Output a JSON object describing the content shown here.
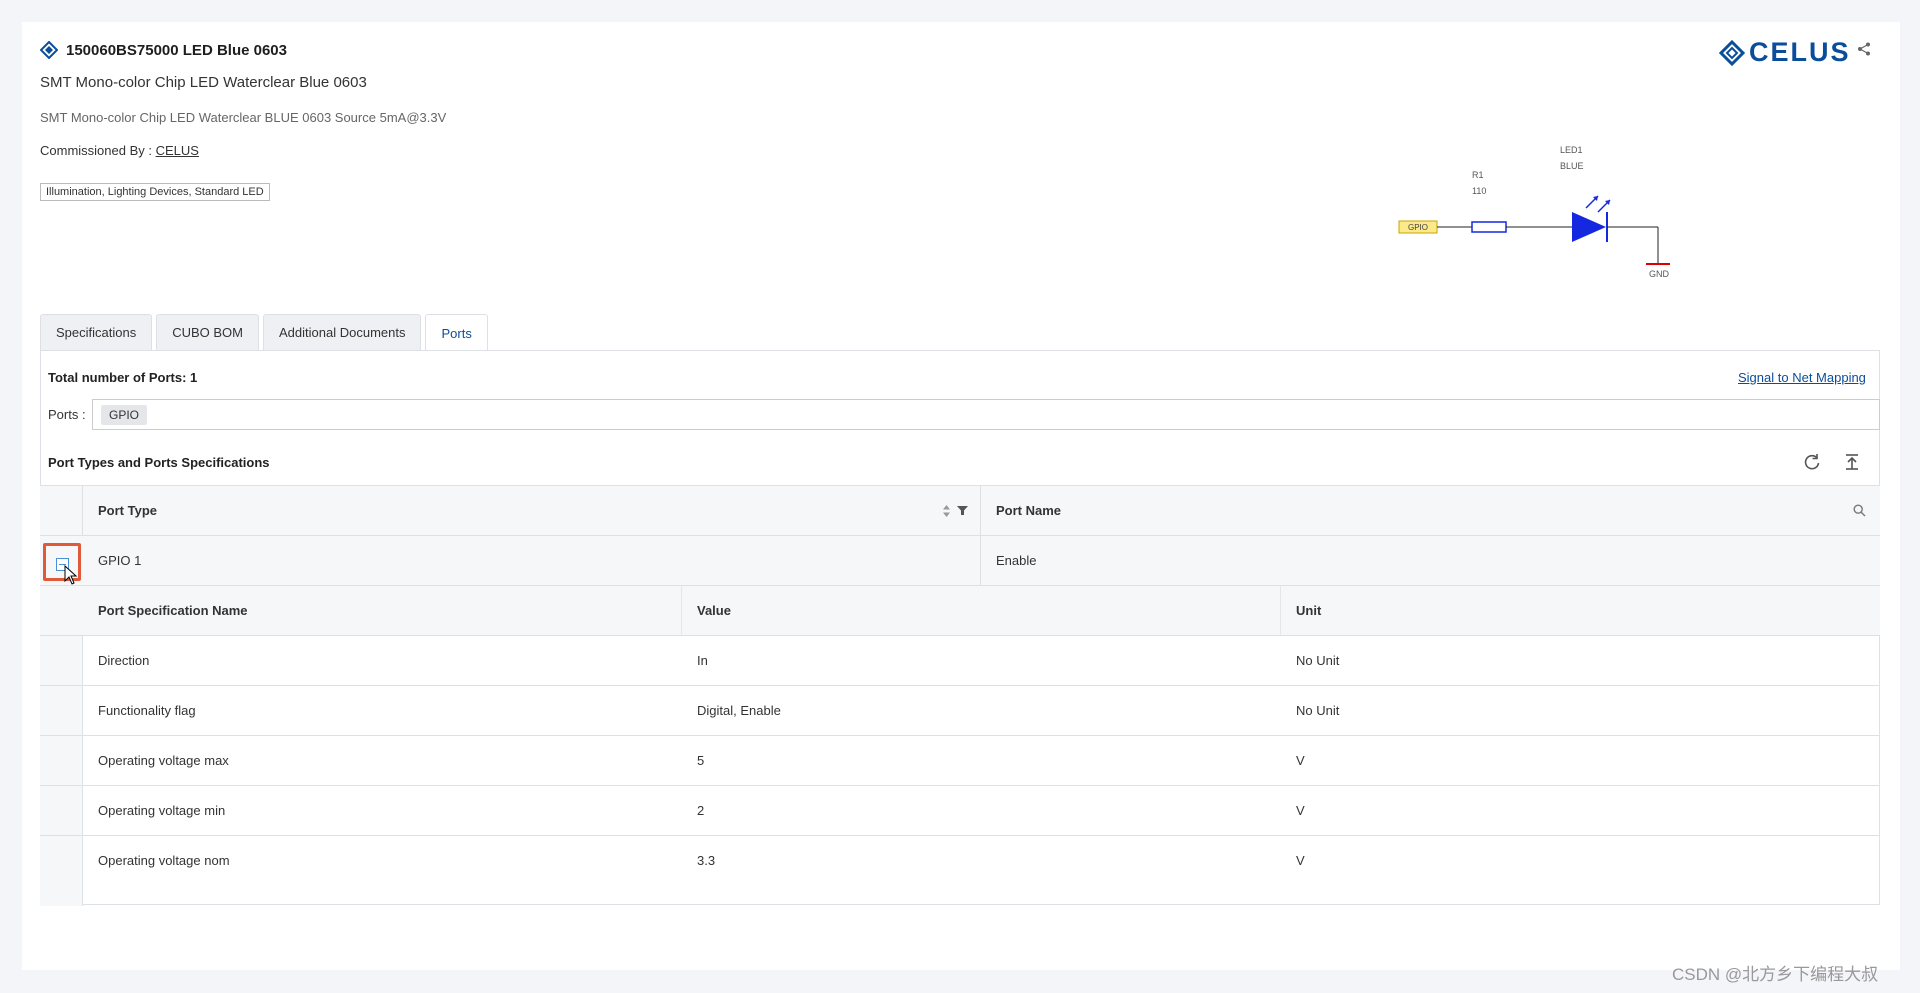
{
  "header": {
    "part_number": "150060BS75000 LED Blue 0603",
    "subtitle": "SMT Mono-color Chip LED Waterclear Blue 0603",
    "description": "SMT Mono-color Chip LED Waterclear BLUE 0603 Source 5mA@3.3V",
    "commissioned_label": "Commissioned By :",
    "commissioned_by": "CELUS",
    "tags": "Illumination, Lighting Devices, Standard LED",
    "logo_text": "CELUS"
  },
  "schematic": {
    "led_ref": "LED1",
    "led_color": "BLUE",
    "res_ref": "R1",
    "res_value": "110",
    "port": "GPIO",
    "gnd": "GND"
  },
  "tabs": [
    {
      "label": "Specifications"
    },
    {
      "label": "CUBO BOM"
    },
    {
      "label": "Additional Documents"
    },
    {
      "label": "Ports"
    }
  ],
  "ports": {
    "total_label": "Total number of Ports: 1",
    "signal_link": "Signal to Net Mapping",
    "ports_label": "Ports :",
    "chip": "GPIO",
    "section_title": "Port Types and Ports Specifications"
  },
  "grid": {
    "col_port_type": "Port Type",
    "col_port_name": "Port Name",
    "row": {
      "type": "GPIO 1",
      "name": "Enable"
    },
    "detail_headers": [
      "Port Specification Name",
      "Value",
      "Unit"
    ],
    "detail_rows": [
      [
        "Direction",
        "In",
        "No Unit"
      ],
      [
        "Functionality flag",
        "Digital, Enable",
        "No Unit"
      ],
      [
        "Operating voltage max",
        "5",
        "V"
      ],
      [
        "Operating voltage min",
        "2",
        "V"
      ],
      [
        "Operating voltage nom",
        "3.3",
        "V"
      ]
    ]
  },
  "watermark": "CSDN @北方乡下编程大叔",
  "colors": {
    "brand": "#0a4e9b",
    "highlight": "#e05a3a",
    "led": "#1428e0"
  }
}
